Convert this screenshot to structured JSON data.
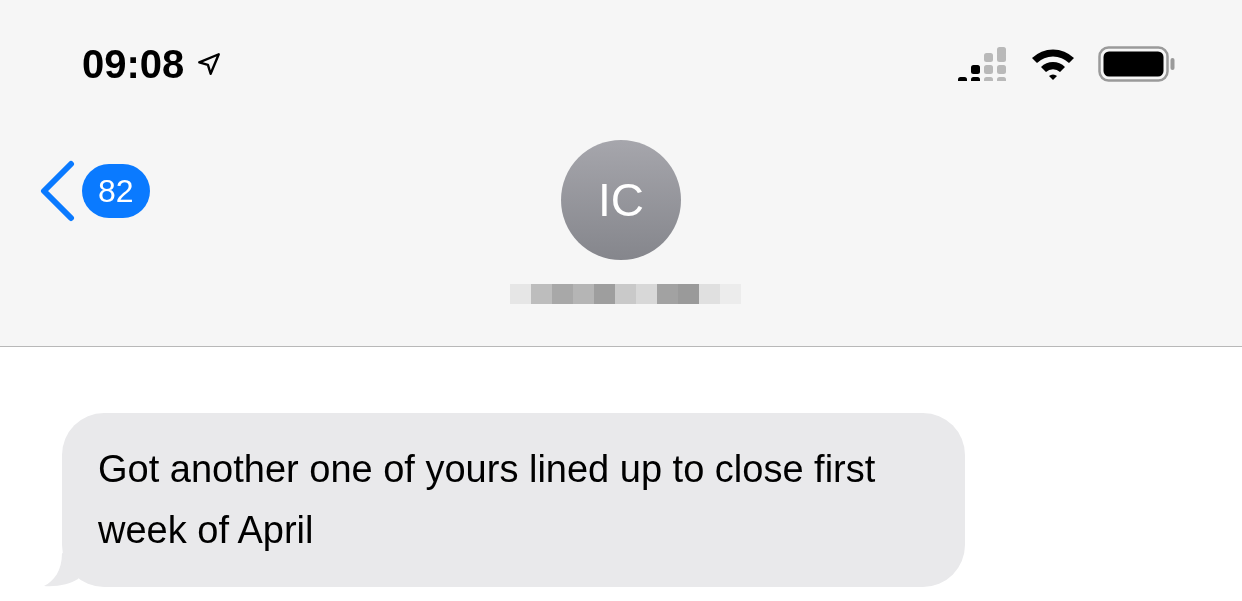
{
  "status_bar": {
    "time": "09:08",
    "location_active": true
  },
  "header": {
    "back_badge": "82",
    "avatar_initials": "IC"
  },
  "messages": [
    {
      "kind": "received",
      "text": "Got another one of yours lined up to close first week of April"
    }
  ]
}
